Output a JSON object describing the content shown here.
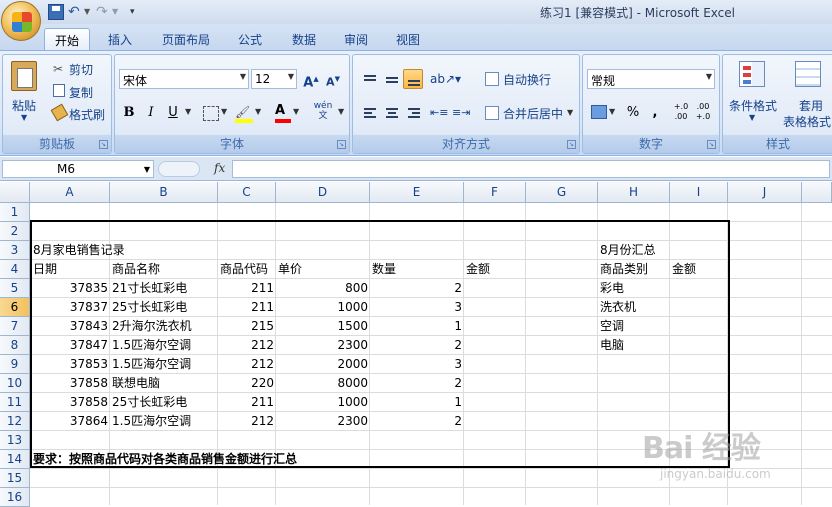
{
  "window": {
    "title": "练习1  [兼容模式] - Microsoft Excel"
  },
  "tabs": [
    "开始",
    "插入",
    "页面布局",
    "公式",
    "数据",
    "审阅",
    "视图"
  ],
  "ribbon": {
    "clipboard": {
      "group_label": "剪贴板",
      "paste": "粘贴",
      "cut": "剪切",
      "copy": "复制",
      "format_painter": "格式刷"
    },
    "font": {
      "group_label": "字体",
      "font_name": "宋体",
      "font_size": "12",
      "bold": "B",
      "italic": "I",
      "underline": "U",
      "pinyin": "wén 文"
    },
    "alignment": {
      "group_label": "对齐方式",
      "wrap_text": "自动换行",
      "merge_center": "合并后居中"
    },
    "number": {
      "group_label": "数字",
      "format": "常规",
      "percent": "%",
      "comma": ",",
      "inc_decimal": "+.0 .00",
      "dec_decimal": ".00 +.0"
    },
    "styles": {
      "group_label": "样式",
      "conditional": "条件格式",
      "table_format_1": "套用",
      "table_format_2": "表格格式"
    }
  },
  "formula_bar": {
    "name_box": "M6",
    "fx": "fx",
    "formula": ""
  },
  "columns": [
    "A",
    "B",
    "C",
    "D",
    "E",
    "F",
    "G",
    "H",
    "I",
    "J"
  ],
  "rows": [
    "1",
    "2",
    "3",
    "4",
    "5",
    "6",
    "7",
    "8",
    "9",
    "10",
    "11",
    "12",
    "13",
    "14",
    "15",
    "16"
  ],
  "sheet": {
    "title": "8月家电销售记录",
    "headers": [
      "日期",
      "商品名称",
      "商品代码",
      "单价",
      "数量",
      "金额"
    ],
    "records": [
      [
        "37835",
        "21寸长虹彩电",
        "211",
        "800",
        "2"
      ],
      [
        "37837",
        "25寸长虹彩电",
        "211",
        "1000",
        "3"
      ],
      [
        "37843",
        "2升海尔洗衣机",
        "215",
        "1500",
        "1"
      ],
      [
        "37847",
        "1.5匹海尔空调",
        "212",
        "2300",
        "2"
      ],
      [
        "37853",
        "1.5匹海尔空调",
        "212",
        "2000",
        "3"
      ],
      [
        "37858",
        "联想电脑",
        "220",
        "8000",
        "2"
      ],
      [
        "37858",
        "25寸长虹彩电",
        "211",
        "1000",
        "1"
      ],
      [
        "37864",
        "1.5匹海尔空调",
        "212",
        "2300",
        "2"
      ]
    ],
    "summary_title": "8月份汇总",
    "summary_headers": [
      "商品类别",
      "金额"
    ],
    "summary_items": [
      "彩电",
      "洗衣机",
      "空调",
      "电脑"
    ],
    "requirement": "要求：按照商品代码对各类商品销售金额进行汇总"
  },
  "watermark": {
    "brand": "Bai 经验",
    "url": "jingyan.baidu.com"
  }
}
